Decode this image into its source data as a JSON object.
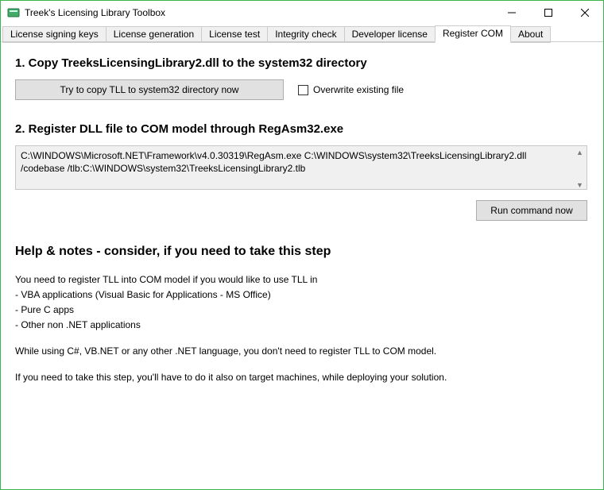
{
  "window": {
    "title": "Treek's Licensing Library Toolbox"
  },
  "tabs": [
    {
      "label": "License signing keys",
      "active": false
    },
    {
      "label": "License generation",
      "active": false
    },
    {
      "label": "License test",
      "active": false
    },
    {
      "label": "Integrity check",
      "active": false
    },
    {
      "label": "Developer license",
      "active": false
    },
    {
      "label": "Register COM",
      "active": true
    },
    {
      "label": "About",
      "active": false
    }
  ],
  "step1": {
    "heading": "1. Copy TreeksLicensingLibrary2.dll to the system32 directory",
    "button": "Try to copy TLL to system32 directory now",
    "checkbox_label": "Overwrite existing file",
    "checkbox_checked": false
  },
  "step2": {
    "heading": "2. Register DLL file to COM model through RegAsm32.exe",
    "command": "C:\\WINDOWS\\Microsoft.NET\\Framework\\v4.0.30319\\RegAsm.exe C:\\WINDOWS\\system32\\TreeksLicensingLibrary2.dll /codebase /tlb:C:\\WINDOWS\\system32\\TreeksLicensingLibrary2.tlb",
    "run_button": "Run command now"
  },
  "help": {
    "heading": "Help & notes - consider, if you need to take this step",
    "lines": [
      "You need to register TLL into COM model if you would like to use TLL in",
      "- VBA applications (Visual Basic for Applications - MS Office)",
      "- Pure C apps",
      "- Other non .NET applications"
    ],
    "p2": "While using C#, VB.NET or any other .NET language, you don't need to register TLL to COM model.",
    "p3": "If you need to take this step, you'll have to do it also on target machines, while deploying your solution."
  }
}
